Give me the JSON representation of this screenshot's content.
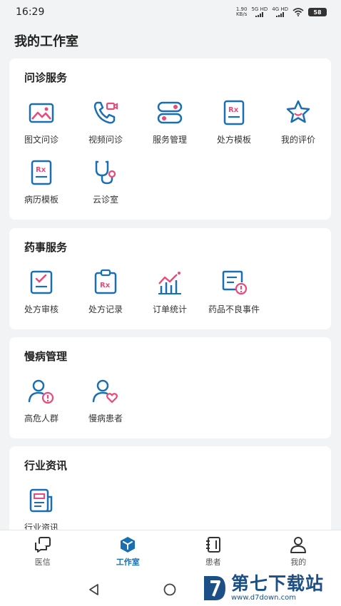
{
  "status": {
    "time": "16:29",
    "net_speed": "1.90",
    "net_unit": "KB/s",
    "sig1": "5G HD",
    "sig2": "4G HD",
    "battery": "58"
  },
  "page_title": "我的工作室",
  "sections": [
    {
      "title": "问诊服务",
      "items": [
        "图文问诊",
        "视频问诊",
        "服务管理",
        "处方模板",
        "我的评价",
        "病历模板",
        "云诊室"
      ]
    },
    {
      "title": "药事服务",
      "items": [
        "处方审核",
        "处方记录",
        "订单统计",
        "药品不良事件"
      ]
    },
    {
      "title": "慢病管理",
      "items": [
        "高危人群",
        "慢病患者"
      ]
    },
    {
      "title": "行业资讯",
      "items": [
        "行业资讯"
      ]
    }
  ],
  "nav": [
    {
      "label": "医信",
      "icon": "chat-icon"
    },
    {
      "label": "工作室",
      "icon": "cube-icon"
    },
    {
      "label": "患者",
      "icon": "notebook-icon"
    },
    {
      "label": "我的",
      "icon": "person-icon"
    }
  ],
  "watermark": {
    "main": "第七下载站",
    "sub": "www.d7down.com"
  },
  "colors": {
    "primary": "#1a6fb3",
    "accent": "#e84a7a",
    "bg": "#f2f3f5"
  }
}
